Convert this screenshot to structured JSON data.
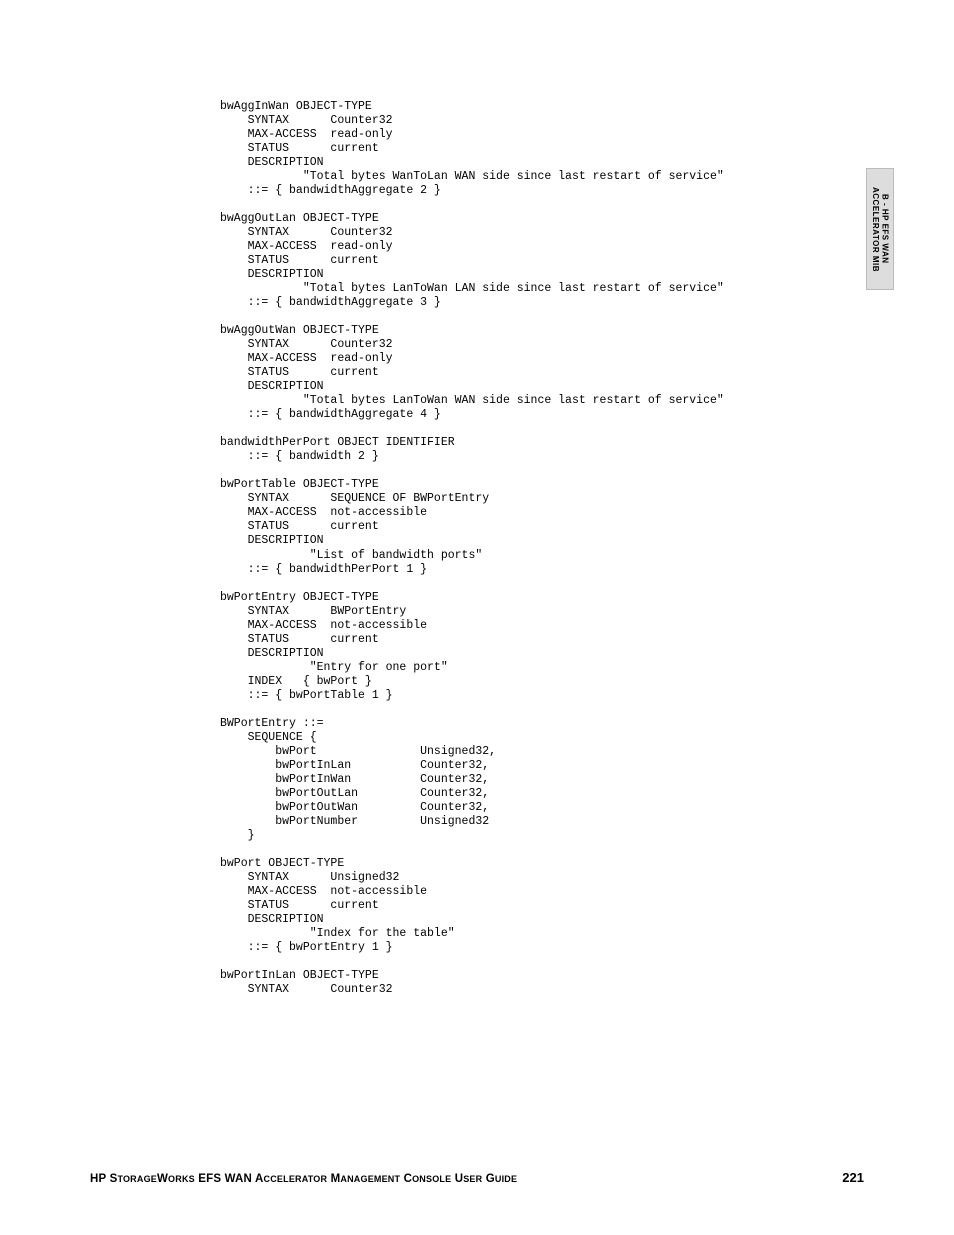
{
  "sidebar": {
    "line1": "B - HP EFS WAN",
    "line2": "ACCELERATOR MIB"
  },
  "mib_text": "bwAggInWan OBJECT-TYPE\n    SYNTAX      Counter32\n    MAX-ACCESS  read-only\n    STATUS      current\n    DESCRIPTION\n            \"Total bytes WanToLan WAN side since last restart of service\"\n    ::= { bandwidthAggregate 2 }\n\nbwAggOutLan OBJECT-TYPE\n    SYNTAX      Counter32\n    MAX-ACCESS  read-only\n    STATUS      current\n    DESCRIPTION\n            \"Total bytes LanToWan LAN side since last restart of service\"\n    ::= { bandwidthAggregate 3 }\n\nbwAggOutWan OBJECT-TYPE\n    SYNTAX      Counter32\n    MAX-ACCESS  read-only\n    STATUS      current\n    DESCRIPTION\n            \"Total bytes LanToWan WAN side since last restart of service\"\n    ::= { bandwidthAggregate 4 }\n\nbandwidthPerPort OBJECT IDENTIFIER\n    ::= { bandwidth 2 }\n\nbwPortTable OBJECT-TYPE\n    SYNTAX      SEQUENCE OF BWPortEntry\n    MAX-ACCESS  not-accessible\n    STATUS      current\n    DESCRIPTION\n             \"List of bandwidth ports\"\n    ::= { bandwidthPerPort 1 }\n\nbwPortEntry OBJECT-TYPE\n    SYNTAX      BWPortEntry\n    MAX-ACCESS  not-accessible\n    STATUS      current\n    DESCRIPTION\n             \"Entry for one port\"\n    INDEX   { bwPort }\n    ::= { bwPortTable 1 }\n\nBWPortEntry ::=\n    SEQUENCE {\n        bwPort               Unsigned32,\n        bwPortInLan          Counter32,\n        bwPortInWan          Counter32,\n        bwPortOutLan         Counter32,\n        bwPortOutWan         Counter32,\n        bwPortNumber         Unsigned32\n    }\n\nbwPort OBJECT-TYPE\n    SYNTAX      Unsigned32\n    MAX-ACCESS  not-accessible\n    STATUS      current\n    DESCRIPTION\n             \"Index for the table\"\n    ::= { bwPortEntry 1 }\n\nbwPortInLan OBJECT-TYPE\n    SYNTAX      Counter32",
  "footer": {
    "title_prefix": "HP S",
    "title_sc1": "TORAGE",
    "title_mid1": "W",
    "title_sc2": "ORKS",
    "title_mid2": " EFS WAN A",
    "title_sc3": "CCELERATOR",
    "title_mid3": " M",
    "title_sc4": "ANAGEMENT",
    "title_mid4": " C",
    "title_sc5": "ONSOLE",
    "title_mid5": " U",
    "title_sc6": "SER",
    "title_mid6": " G",
    "title_sc7": "UIDE",
    "page_number": "221"
  }
}
